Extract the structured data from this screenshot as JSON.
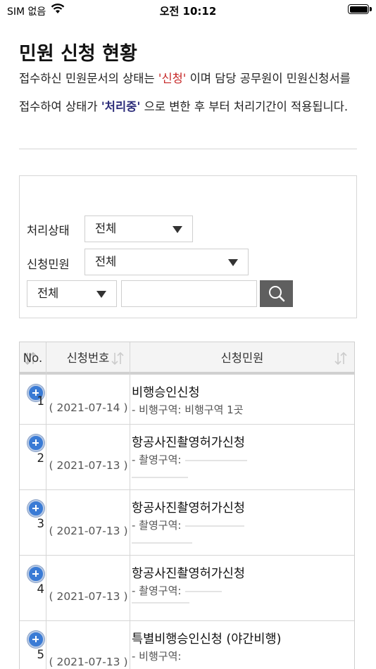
{
  "status_bar": {
    "carrier": "SIM 없음",
    "time": "오전 10:12"
  },
  "page": {
    "title": "민원 신청 현황",
    "desc_part1": "접수하신 민원문서의 상태는 ",
    "desc_status1": "'신청'",
    "desc_part2": " 이며 담당 공무원이 민원신청서를 접수하여 상태가 ",
    "desc_status2": "'처리중'",
    "desc_part3": " 으로 변한 후 부터 처리기간이 적용됩니다."
  },
  "filters": {
    "status_label": "처리상태",
    "status_value": "전체",
    "type_label": "신청민원",
    "type_value": "전체",
    "field_value": "전체",
    "search_text": ""
  },
  "table": {
    "headers": [
      "No.",
      "신청번호",
      "신청민원"
    ],
    "rows": [
      {
        "no": "1",
        "date": "( 2021-07-14 )",
        "title": "비행승인신청",
        "sub": "- 비행구역: 비행구역 1곳"
      },
      {
        "no": "2",
        "date": "( 2021-07-13 )",
        "title": "항공사진촬영허가신청",
        "sub": "- 촬영구역:"
      },
      {
        "no": "3",
        "date": "( 2021-07-13 )",
        "title": "항공사진촬영허가신청",
        "sub": "- 촬영구역:"
      },
      {
        "no": "4",
        "date": "( 2021-07-13 )",
        "title": "항공사진촬영허가신청",
        "sub": "- 촬영구역:"
      },
      {
        "no": "5",
        "date": "( 2021-07-13 )",
        "title": "특별비행승인신청 (야간비행)",
        "sub": "- 비행구역:"
      }
    ]
  }
}
